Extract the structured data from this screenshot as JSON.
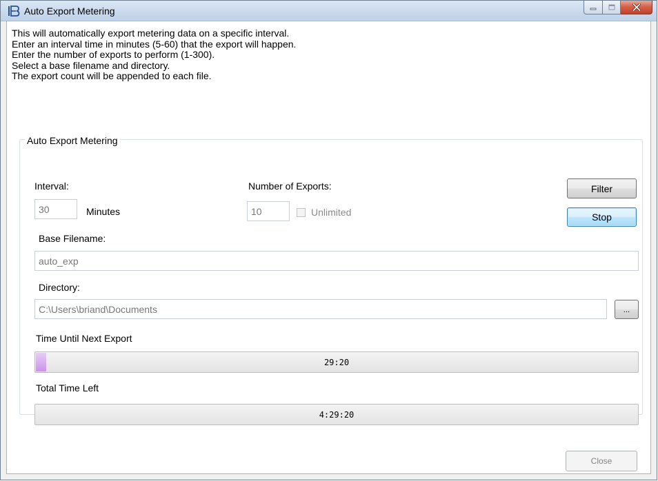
{
  "window": {
    "title": "Auto Export Metering",
    "icon": "app-logo-icon",
    "controls": {
      "minimize": "minimize-icon",
      "maximize": "maximize-icon",
      "close": "close-icon"
    }
  },
  "intro": {
    "lines": [
      "This will automatically export metering data on a specific interval.",
      "Enter an interval time in minutes (5-60) that the export will happen.",
      "Enter the number of exports to perform (1-300).",
      "Select a base filename and directory.",
      "The export count will be appended to each file."
    ]
  },
  "group": {
    "title": "Auto Export Metering",
    "interval": {
      "label": "Interval:",
      "value": "30",
      "unit": "Minutes"
    },
    "exports": {
      "label": "Number of Exports:",
      "value": "10",
      "unlimited_label": "Unlimited",
      "unlimited_checked": false
    },
    "buttons": {
      "filter": "Filter",
      "stop": "Stop",
      "browse": "..."
    },
    "base_filename": {
      "label": "Base Filename:",
      "value": "auto_exp"
    },
    "directory": {
      "label": "Directory:",
      "value": "C:\\Users\\briand\\Documents"
    },
    "next_export": {
      "label": "Time Until Next Export",
      "text": "29:20",
      "progress": 0.0167
    },
    "total_left": {
      "label": "Total Time Left",
      "text": "4:29:20",
      "progress": 0.0
    }
  },
  "footer": {
    "close_label": "Close"
  },
  "colors": {
    "progress_fill": "#c995e8",
    "close_button": "#c0402a",
    "default_button_border": "#3c7fb1"
  }
}
